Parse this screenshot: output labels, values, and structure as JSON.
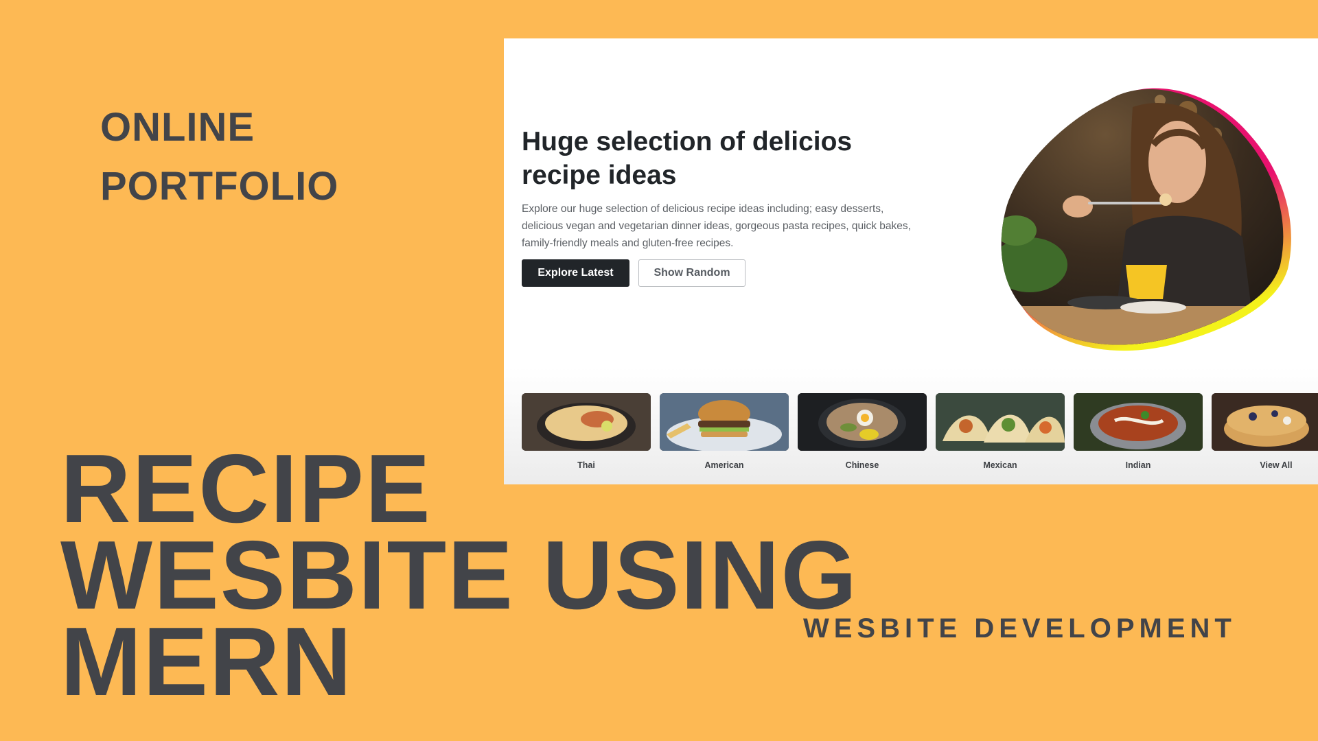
{
  "poster": {
    "kicker_lines": [
      "ONLINE",
      "PORTFOLIO"
    ],
    "headline_lines": [
      "RECIPE",
      "WESBITE USING",
      "MERN"
    ],
    "subhead": "WESBITE DEVELOPMENT"
  },
  "hero": {
    "title": "Huge selection of delicios recipe ideas",
    "description": "Explore our huge selection of delicious recipe ideas including; easy desserts, delicious vegan and vegetarian dinner ideas, gorgeous pasta recipes, quick bakes, family-friendly meals and gluten-free recipes.",
    "primary_button": "Explore Latest",
    "secondary_button": "Show Random"
  },
  "categories": [
    {
      "label": "Thai",
      "icon": "thai-dish-image"
    },
    {
      "label": "American",
      "icon": "burger-image"
    },
    {
      "label": "Chinese",
      "icon": "noodle-bowl-image"
    },
    {
      "label": "Mexican",
      "icon": "tacos-image"
    },
    {
      "label": "Indian",
      "icon": "curry-image"
    },
    {
      "label": "View All",
      "icon": "pancakes-image"
    }
  ],
  "colors": {
    "background": "#FDB954",
    "text_dark": "#424449",
    "button_dark": "#212529",
    "blob_accent_pink": "#E8126E",
    "blob_accent_yellow": "#F4F21A"
  }
}
